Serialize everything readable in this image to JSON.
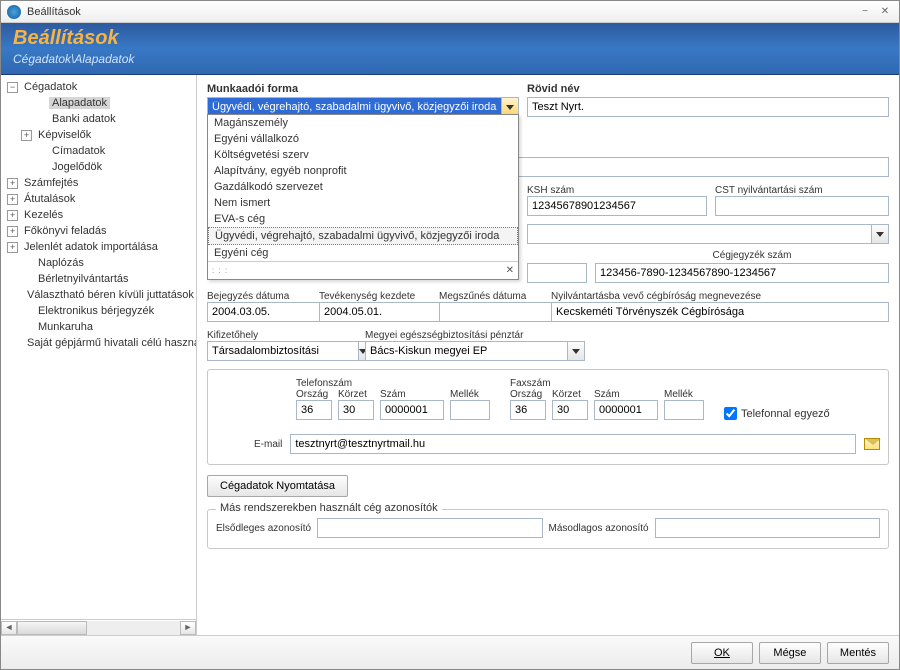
{
  "window": {
    "title": "Beállítások",
    "minimize_icon": "−",
    "close_icon": "✕"
  },
  "header": {
    "title": "Beállítások",
    "breadcrumb": "Cégadatok\\Alapadatok"
  },
  "tree": {
    "root": "Cégadatok",
    "children": [
      "Alapadatok",
      "Banki adatok",
      "Képviselők",
      "Címadatok",
      "Jogelődök"
    ],
    "rest": [
      "Számfejtés",
      "Átutalások",
      "Kezelés",
      "Főkönyvi feladás",
      "Jelenlét adatok importálása",
      "Naplózás",
      "Bérletnyilvántartás",
      "Választható béren kívüli juttatások",
      "Elektronikus bérjegyzék",
      "Munkaruha",
      "Saját gépjármű hivatali célú használata"
    ]
  },
  "form": {
    "munkaadoi_label": "Munkaadói forma",
    "munkaadoi_value": "Ügyvédi, végrehajtó, szabadalmi ügyvivő, közjegyzői iroda",
    "munkaadoi_options": [
      "Magánszemély",
      "Egyéni vállalkozó",
      "Költségvetési szerv",
      "Alapítvány, egyéb nonprofit",
      "Gazdálkodó szervezet",
      "Nem ismert",
      "EVA-s cég",
      "Ügyvédi, végrehajtó, szabadalmi ügyvivő, közjegyzői iroda",
      "Egyéni cég"
    ],
    "rovid_nev_label": "Rövid név",
    "rovid_nev_value": "Teszt Nyrt.",
    "ksh_label": "KSH szám",
    "ksh_value": "12345678901234567",
    "cst_label": "CST nyilvántartási szám",
    "bejegyzes_label": "Bejegyzés dátuma",
    "bejegyzes_value": "2004.03.05.",
    "tevekenyseg_label": "Tevékenység kezdete",
    "tevekenyseg_value": "2004.05.01.",
    "megszunes_label": "Megszűnés dátuma",
    "cegjegyzek_label": "Cégjegyzék szám",
    "cegjegyzek_value": "123456-7890-1234567890-1234567",
    "nyilvantartas_label": "Nyilvántartásba vevő cégbíróság megnevezése",
    "nyilvantartas_value": "Kecskeméti Törvényszék Cégbírósága",
    "kifizetohely_label": "Kifizetőhely",
    "kifizetohely_value": "Társadalombiztosítási",
    "megyei_label": "Megyei egészségbiztosítási pénztár",
    "megyei_value": "Bács-Kiskun megyei EP",
    "telefon_legend": "Telefonszám",
    "fax_legend": "Faxszám",
    "col_orszag": "Ország",
    "col_korzet": "Körzet",
    "col_szam": "Szám",
    "col_mellek": "Mellék",
    "tel_orszag": "36",
    "tel_korzet": "30",
    "tel_szam": "0000001",
    "fax_orszag": "36",
    "fax_korzet": "30",
    "fax_szam": "0000001",
    "fax_same_label": "Telefonnal egyező",
    "email_label": "E-mail",
    "email_value": "tesztnyrt@tesztnyrtmail.hu",
    "print_label": "Cégadatok Nyomtatása",
    "mas_legend": "Más rendszerekben használt cég azonosítók",
    "elsodleges_label": "Elsődleges azonosító",
    "masodlagos_label": "Másodlagos azonosító"
  },
  "footer": {
    "ok": "OK",
    "cancel": "Mégse",
    "save": "Mentés"
  }
}
